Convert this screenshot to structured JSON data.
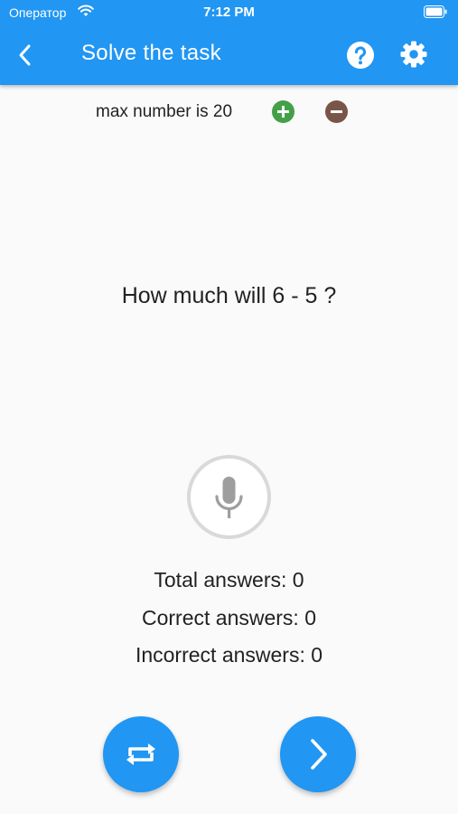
{
  "status_bar": {
    "carrier": "Оператор",
    "time": "7:12 PM"
  },
  "app_bar": {
    "title": "Solve the task",
    "icons": [
      "chevron-left-icon",
      "help-icon",
      "gear-icon"
    ]
  },
  "max_number": {
    "label": "max number is 20",
    "plus_icon": "plus-circle-icon",
    "minus_icon": "minus-circle-icon"
  },
  "task": {
    "question": "How much will 6 - 5 ?"
  },
  "mic": {
    "icon": "microphone-icon"
  },
  "stats": {
    "total": "Total answers: 0",
    "correct": "Correct answers: 0",
    "incorrect": "Incorrect answers: 0"
  },
  "actions": {
    "repeat_icon": "repeat-icon",
    "next_icon": "chevron-right-icon"
  },
  "colors": {
    "primary": "#2196f3",
    "plus": "#43a047",
    "minus": "#795548",
    "background": "#fafafa"
  }
}
